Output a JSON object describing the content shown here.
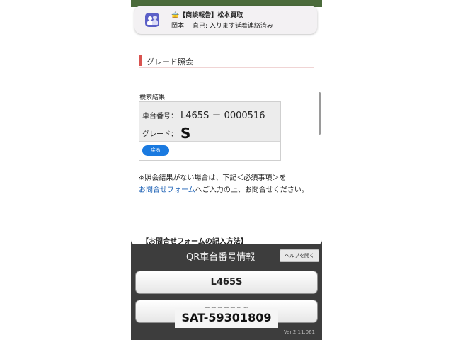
{
  "notification": {
    "app_icon": "teams-icon",
    "title_icon": "car-icon",
    "title": "【商談報告】松本買取",
    "sender": "岡本",
    "message": "直己: 入ります延着連絡済み"
  },
  "section": {
    "heading": "グレード照会"
  },
  "result": {
    "label": "検索結果",
    "chassis_key": "車台番号：",
    "chassis_value": "L465S － 0000516",
    "grade_key": "グレード：",
    "grade_value": "S",
    "back_label": "戻る"
  },
  "note": {
    "text_before": "※照会結果がない場合は、下記＜必須事項＞を",
    "link": "お問合せフォーム",
    "text_after": "へご入力の上、お問合せください。"
  },
  "how_to": "【お問合せフォームの記入方法】",
  "qr": {
    "title": "QR車台番号情報",
    "help_label": "ヘルプを開く",
    "model": "L465S",
    "serial": "0000516"
  },
  "version": "Ver.2.11.061",
  "overlay_label": "SAT-59301809",
  "colors": {
    "accent_red": "#d9534f",
    "button_blue": "#1a7ae0",
    "link_blue": "#1a5fb4",
    "teams_purple": "#5b5fc7"
  }
}
